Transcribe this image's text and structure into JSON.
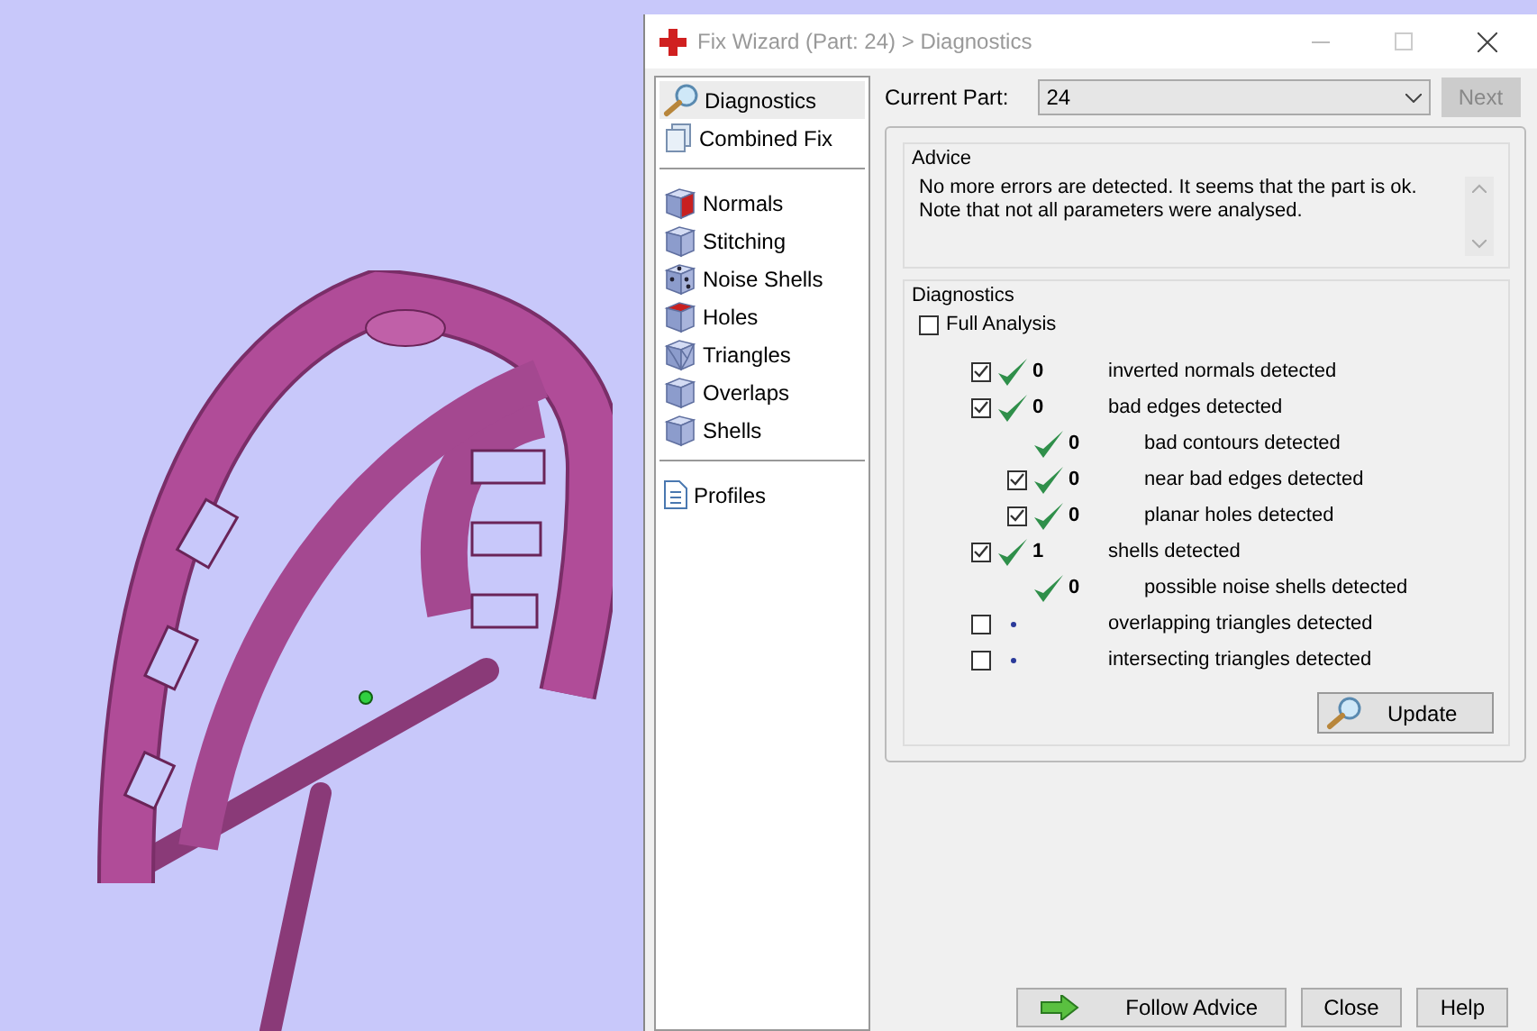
{
  "window": {
    "title": "Fix Wizard (Part: 24) > Diagnostics"
  },
  "sidebar": {
    "groups": [
      [
        {
          "label": "Diagnostics",
          "kind": "magnifier",
          "selected": true
        },
        {
          "label": "Combined Fix",
          "kind": "stack",
          "selected": false
        }
      ],
      [
        {
          "label": "Normals",
          "kind": "cube-red",
          "selected": false
        },
        {
          "label": "Stitching",
          "kind": "cube",
          "selected": false
        },
        {
          "label": "Noise Shells",
          "kind": "cube-dots",
          "selected": false
        },
        {
          "label": "Holes",
          "kind": "cube-red-top",
          "selected": false
        },
        {
          "label": "Triangles",
          "kind": "cube-tri",
          "selected": false
        },
        {
          "label": "Overlaps",
          "kind": "cube",
          "selected": false
        },
        {
          "label": "Shells",
          "kind": "cube",
          "selected": false
        }
      ],
      [
        {
          "label": "Profiles",
          "kind": "document",
          "selected": false
        }
      ]
    ]
  },
  "current_part": {
    "label": "Current Part:",
    "value": "24",
    "next_button": "Next"
  },
  "advice": {
    "title": "Advice",
    "text": "No more errors are detected. It seems that the part is ok.\nNote that not all parameters were analysed."
  },
  "diagnostics": {
    "title": "Diagnostics",
    "full_analysis": {
      "label": "Full Analysis",
      "checked": false
    },
    "rows": [
      {
        "label": "inverted normals detected",
        "count": "0",
        "kind": "check",
        "checked": true
      },
      {
        "label": "bad edges detected",
        "count": "0",
        "kind": "check",
        "checked": true,
        "children": [
          {
            "label": "bad contours detected",
            "count": "0",
            "kind": "check"
          },
          {
            "label": "near bad edges detected",
            "count": "0",
            "kind": "check",
            "checked": true
          },
          {
            "label": "planar holes detected",
            "count": "0",
            "kind": "check",
            "checked": true
          }
        ]
      },
      {
        "label": "shells detected",
        "count": "1",
        "kind": "check",
        "checked": true,
        "children": [
          {
            "label": "possible noise shells detected",
            "count": "0",
            "kind": "check"
          }
        ]
      },
      {
        "label": "overlapping triangles detected",
        "kind": "dot",
        "checked": false
      },
      {
        "label": "intersecting triangles detected",
        "kind": "dot",
        "checked": false
      }
    ],
    "update_button": "Update"
  },
  "buttons": [
    "Follow Advice",
    "Close",
    "Help"
  ]
}
